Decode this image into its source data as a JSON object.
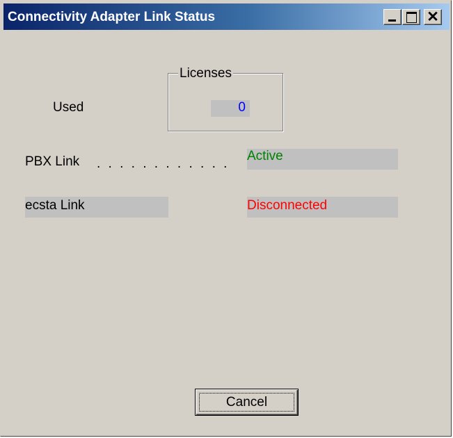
{
  "window": {
    "title": "Connectivity Adapter Link Status",
    "controls": {
      "minimize": "minimize-icon",
      "maximize": "maximize-icon",
      "close": "close-icon"
    }
  },
  "licenses": {
    "group_label": "Licenses",
    "used_label": "Used",
    "used_value": "0"
  },
  "links": {
    "pbx": {
      "label": "PBX Link",
      "leader": ". . . . . . . . . . . .",
      "status": "Active",
      "status_color": "#008000"
    },
    "ecsta": {
      "label": "ecsta Link",
      "status": "Disconnected",
      "status_color": "#ff0000"
    }
  },
  "buttons": {
    "cancel_label": "Cancel"
  },
  "colors": {
    "title_start": "#0a246a",
    "title_end": "#a6caf0",
    "value_blue": "#0000ff",
    "field_bg": "#c0c0c0"
  }
}
